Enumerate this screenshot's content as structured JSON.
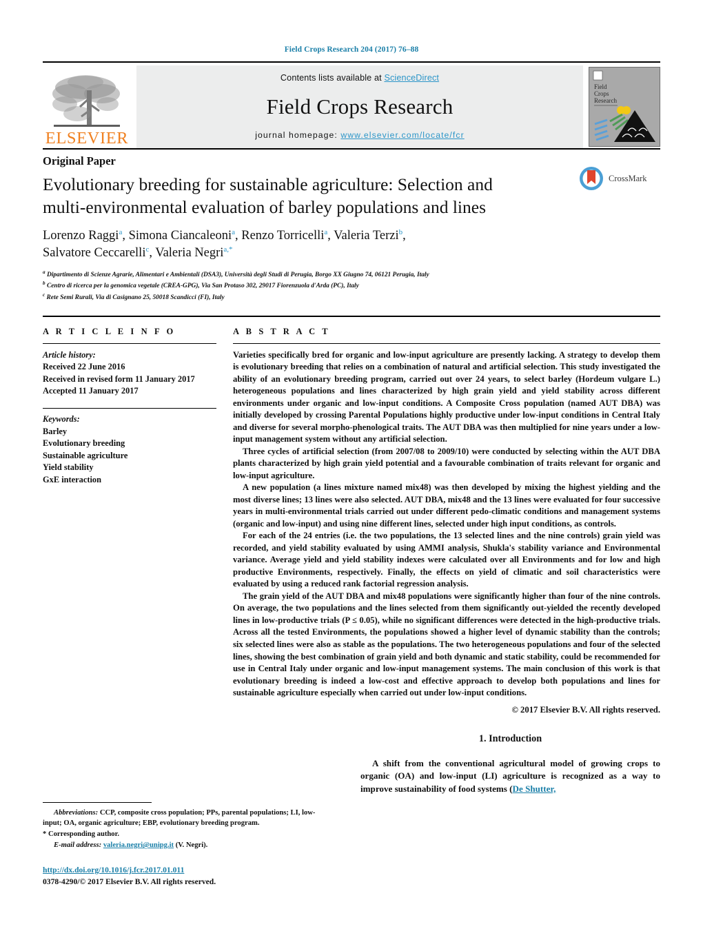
{
  "running_head": "Field Crops Research 204 (2017) 76–88",
  "masthead": {
    "contents_prefix": "Contents lists available at ",
    "sciencedirect": "ScienceDirect",
    "journal_name": "Field Crops Research",
    "homepage_prefix": "journal homepage: ",
    "homepage_url": "www.elsevier.com/locate/fcr",
    "publisher": "ELSEVIER",
    "cover_title_line1": "Field",
    "cover_title_line2": "Crops",
    "cover_title_line3": "Research",
    "accent_link_color": "#2b95c8",
    "publisher_color": "#F08121"
  },
  "article": {
    "type": "Original Paper",
    "title": "Evolutionary breeding for sustainable agriculture: Selection and multi-environmental evaluation of barley populations and lines",
    "authors_line1": "Lorenzo Raggi",
    "authors_html": "Lorenzo Raggi<sup>a</sup>, Simona Ciancaleoni<sup>a</sup>, Renzo Torricelli<sup>a</sup>, Valeria Terzi<sup>b</sup>, Salvatore Ceccarelli<sup>c</sup>, Valeria Negri<sup>a,*</sup>",
    "affiliation_a": "Dipartimento di Scienze Agrarie, Alimentari e Ambientali (DSA3), Università degli Studi di Perugia, Borgo XX Giugno 74, 06121 Perugia, Italy",
    "affiliation_b": "Centro di ricerca per la genomica vegetale (CREA-GPG), Via San Protaso 302, 29017 Fiorenzuola d'Arda (PC), Italy",
    "affiliation_c": "Rete Semi Rurali, Via di Casignano 25, 50018 Scandicci (FI), Italy",
    "crossmark_label": "CrossMark"
  },
  "article_info": {
    "heading": "A R T I C L E   I N F O",
    "history_label": "Article history:",
    "history": [
      "Received 22 June 2016",
      "Received in revised form 11 January 2017",
      "Accepted 11 January 2017"
    ],
    "keywords_label": "Keywords:",
    "keywords": [
      "Barley",
      "Evolutionary breeding",
      "Sustainable agriculture",
      "Yield stability",
      "GxE interaction"
    ]
  },
  "abstract": {
    "heading": "A B S T R A C T",
    "paragraphs": [
      "Varieties specifically bred for organic and low-input agriculture are presently lacking. A strategy to develop them is evolutionary breeding that relies on a combination of natural and artificial selection. This study investigated the ability of an evolutionary breeding program, carried out over 24 years, to select barley (Hordeum vulgare L.) heterogeneous populations and lines characterized by high grain yield and yield stability across different environments under organic and low-input conditions. A Composite Cross population (named AUT DBA) was initially developed by crossing Parental Populations highly productive under low-input conditions in Central Italy and diverse for several morpho-phenological traits. The AUT DBA was then multiplied for nine years under a low-input management system without any artificial selection.",
      "Three cycles of artificial selection (from 2007/08 to 2009/10) were conducted by selecting within the AUT DBA plants characterized by high grain yield potential and a favourable combination of traits relevant for organic and low-input agriculture.",
      "A new population (a lines mixture named mix48) was then developed by mixing the highest yielding and the most diverse lines; 13 lines were also selected. AUT DBA, mix48 and the 13 lines were evaluated for four successive years in multi-environmental trials carried out under different pedo-climatic conditions and management systems (organic and low-input) and using nine different lines, selected under high input conditions, as controls.",
      "For each of the 24 entries (i.e. the two populations, the 13 selected lines and the nine controls) grain yield was recorded, and yield stability evaluated by using AMMI analysis, Shukla's stability variance and Environmental variance. Average yield and yield stability indexes were calculated over all Environments and for low and high productive Environments, respectively. Finally, the effects on yield of climatic and soil characteristics were evaluated by using a reduced rank factorial regression analysis.",
      "The grain yield of the AUT DBA and mix48 populations were significantly higher than four of the nine controls. On average, the two populations and the lines selected from them significantly out-yielded the recently developed lines in low-productive trials (P ≤ 0.05), while no significant differences were detected in the high-productive trials. Across all the tested Environments, the populations showed a higher level of dynamic stability than the controls; six selected lines were also as stable as the populations. The two heterogeneous populations and four of the selected lines, showing the best combination of grain yield and both dynamic and static stability, could be recommended for use in Central Italy under organic and low-input management systems. The main conclusion of this work is that evolutionary breeding is indeed a low-cost and effective approach to develop both populations and lines for sustainable agriculture especially when carried out under low-input conditions."
    ],
    "copyright": "© 2017 Elsevier B.V. All rights reserved."
  },
  "footnotes": {
    "abbreviations_label": "Abbreviations:",
    "abbreviations_text": "CCP, composite cross population; PPs, parental populations; LI, low-input; OA, organic agriculture; EBP, evolutionary breeding program.",
    "corresponding_author": "* Corresponding author.",
    "email_label": "E-mail address:",
    "email": "valeria.negri@unipg.it",
    "email_suffix": "(V. Negri)."
  },
  "publication_footer": {
    "doi": "http://dx.doi.org/10.1016/j.fcr.2017.01.011",
    "issn_line": "0378-4290/© 2017 Elsevier B.V. All rights reserved."
  },
  "introduction": {
    "heading": "1. Introduction",
    "text_before_cite": "A shift from the conventional agricultural model of growing crops to organic (OA) and low-input (LI) agriculture is recognized as a way to improve sustainability of food systems (",
    "citation": "De Shutter,",
    "text_after_cite": ""
  }
}
